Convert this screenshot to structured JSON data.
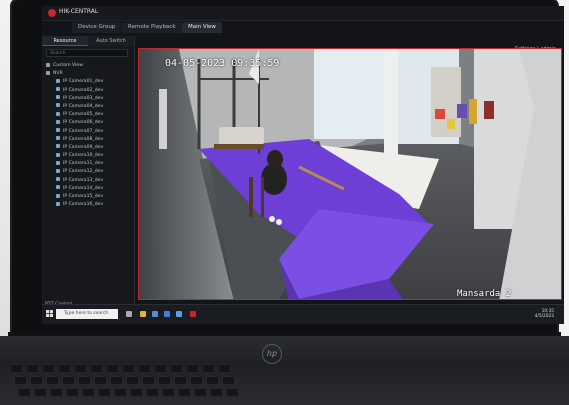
{
  "app": {
    "name": "HIK-CENTRAL"
  },
  "tabs": [
    {
      "label": "Device Group",
      "active": false
    },
    {
      "label": "Remote Playback",
      "active": false
    },
    {
      "label": "Main View",
      "active": true
    }
  ],
  "toolbar": {
    "right_text": "Settings  |  admin"
  },
  "sidebar": {
    "tabs": [
      {
        "label": "Resource",
        "active": true
      },
      {
        "label": "Auto Switch",
        "active": false
      }
    ],
    "search_placeholder": "Search",
    "tree": [
      {
        "label": "Custom View",
        "type": "group"
      },
      {
        "label": "NVR",
        "type": "group"
      },
      {
        "label": "IP Camera01_dev",
        "type": "cam"
      },
      {
        "label": "IP Camera02_dev",
        "type": "cam"
      },
      {
        "label": "IP Camera03_dev",
        "type": "cam"
      },
      {
        "label": "IP Camera04_dev",
        "type": "cam"
      },
      {
        "label": "IP Camera05_dev",
        "type": "cam"
      },
      {
        "label": "IP Camera06_dev",
        "type": "cam"
      },
      {
        "label": "IP Camera07_dev",
        "type": "cam"
      },
      {
        "label": "IP Camera08_dev",
        "type": "cam"
      },
      {
        "label": "IP Camera09_dev",
        "type": "cam"
      },
      {
        "label": "IP Camera10_dev",
        "type": "cam"
      },
      {
        "label": "IP Camera11_dev",
        "type": "cam"
      },
      {
        "label": "IP Camera12_dev",
        "type": "cam"
      },
      {
        "label": "IP Camera13_dev",
        "type": "cam"
      },
      {
        "label": "IP Camera14_dev",
        "type": "cam"
      },
      {
        "label": "IP Camera15_dev",
        "type": "cam"
      },
      {
        "label": "IP Camera16_dev",
        "type": "cam"
      }
    ],
    "footer": "PTZ Control"
  },
  "video": {
    "timestamp": "04-05-2023  09:35:59",
    "camera_label": "Mansarda 2"
  },
  "taskbar": {
    "search_placeholder": "Type here to search",
    "time": "10:35",
    "date": "4/5/2023"
  },
  "laptop": {
    "brand": "hp"
  }
}
